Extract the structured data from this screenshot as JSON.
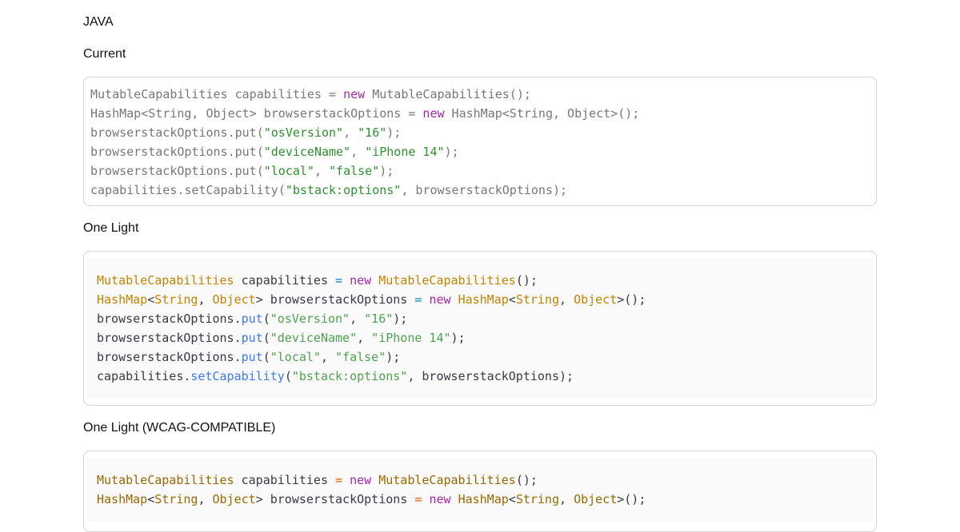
{
  "language_heading": "JAVA",
  "sections": {
    "current": {
      "label": "Current",
      "lines": [
        [
          [
            "plain",
            "MutableCapabilities capabilities = "
          ],
          [
            "kw",
            "new"
          ],
          [
            "plain",
            " MutableCapabilities();"
          ]
        ],
        [
          [
            "plain",
            "HashMap<String, Object> browserstackOptions = "
          ],
          [
            "kw",
            "new"
          ],
          [
            "plain",
            " HashMap<String, Object>();"
          ]
        ],
        [
          [
            "plain",
            "browserstackOptions.put("
          ],
          [
            "str",
            "\"osVersion\""
          ],
          [
            "plain",
            ", "
          ],
          [
            "str",
            "\"16\""
          ],
          [
            "plain",
            ");"
          ]
        ],
        [
          [
            "plain",
            "browserstackOptions.put("
          ],
          [
            "str",
            "\"deviceName\""
          ],
          [
            "plain",
            ", "
          ],
          [
            "str",
            "\"iPhone 14\""
          ],
          [
            "plain",
            ");"
          ]
        ],
        [
          [
            "plain",
            "browserstackOptions.put("
          ],
          [
            "str",
            "\"local\""
          ],
          [
            "plain",
            ", "
          ],
          [
            "str",
            "\"false\""
          ],
          [
            "plain",
            ");"
          ]
        ],
        [
          [
            "plain",
            "capabilities.setCapability("
          ],
          [
            "str",
            "\"bstack:options\""
          ],
          [
            "plain",
            ", browserstackOptions);"
          ]
        ]
      ]
    },
    "one_light": {
      "label": "One Light",
      "lines": [
        [
          [
            "type",
            "MutableCapabilities"
          ],
          [
            "plain",
            " capabilities "
          ],
          [
            "op",
            "="
          ],
          [
            "plain",
            " "
          ],
          [
            "kw",
            "new"
          ],
          [
            "plain",
            " "
          ],
          [
            "type",
            "MutableCapabilities"
          ],
          [
            "plain",
            "();"
          ]
        ],
        [
          [
            "type",
            "HashMap"
          ],
          [
            "plain",
            "<"
          ],
          [
            "type",
            "String"
          ],
          [
            "plain",
            ", "
          ],
          [
            "type",
            "Object"
          ],
          [
            "plain",
            "> browserstackOptions "
          ],
          [
            "op",
            "="
          ],
          [
            "plain",
            " "
          ],
          [
            "kw",
            "new"
          ],
          [
            "plain",
            " "
          ],
          [
            "type",
            "HashMap"
          ],
          [
            "plain",
            "<"
          ],
          [
            "type",
            "String"
          ],
          [
            "plain",
            ", "
          ],
          [
            "type",
            "Object"
          ],
          [
            "plain",
            ">();"
          ]
        ],
        [
          [
            "plain",
            "browserstackOptions."
          ],
          [
            "fn",
            "put"
          ],
          [
            "plain",
            "("
          ],
          [
            "str",
            "\"osVersion\""
          ],
          [
            "plain",
            ", "
          ],
          [
            "str",
            "\"16\""
          ],
          [
            "plain",
            ");"
          ]
        ],
        [
          [
            "plain",
            "browserstackOptions."
          ],
          [
            "fn",
            "put"
          ],
          [
            "plain",
            "("
          ],
          [
            "str",
            "\"deviceName\""
          ],
          [
            "plain",
            ", "
          ],
          [
            "str",
            "\"iPhone 14\""
          ],
          [
            "plain",
            ");"
          ]
        ],
        [
          [
            "plain",
            "browserstackOptions."
          ],
          [
            "fn",
            "put"
          ],
          [
            "plain",
            "("
          ],
          [
            "str",
            "\"local\""
          ],
          [
            "plain",
            ", "
          ],
          [
            "str",
            "\"false\""
          ],
          [
            "plain",
            ");"
          ]
        ],
        [
          [
            "plain",
            "capabilities."
          ],
          [
            "fn",
            "setCapability"
          ],
          [
            "plain",
            "("
          ],
          [
            "str",
            "\"bstack:options\""
          ],
          [
            "plain",
            ", browserstackOptions);"
          ]
        ]
      ]
    },
    "one_light_wcag": {
      "label": "One Light (WCAG-COMPATIBLE)",
      "lines": [
        [
          [
            "type",
            "MutableCapabilities"
          ],
          [
            "plain",
            " capabilities "
          ],
          [
            "op",
            "="
          ],
          [
            "plain",
            " "
          ],
          [
            "kw",
            "new"
          ],
          [
            "plain",
            " "
          ],
          [
            "type",
            "MutableCapabilities"
          ],
          [
            "plain",
            "();"
          ]
        ],
        [
          [
            "type",
            "HashMap"
          ],
          [
            "plain",
            "<"
          ],
          [
            "type",
            "String"
          ],
          [
            "plain",
            ", "
          ],
          [
            "type",
            "Object"
          ],
          [
            "plain",
            "> browserstackOptions "
          ],
          [
            "op",
            "="
          ],
          [
            "plain",
            " "
          ],
          [
            "kw",
            "new"
          ],
          [
            "plain",
            " "
          ],
          [
            "type",
            "HashMap"
          ],
          [
            "plain",
            "<"
          ],
          [
            "type",
            "String"
          ],
          [
            "plain",
            ", "
          ],
          [
            "type",
            "Object"
          ],
          [
            "plain",
            ">();"
          ]
        ]
      ]
    }
  },
  "colors": {
    "current_keyword": "#a626a4",
    "current_string": "#2f8f2f",
    "one_light_type": "#c18401",
    "one_light_string": "#50a14f",
    "one_light_function": "#4078f2",
    "one_light_operator": "#0184bc",
    "wcag_type": "#986801",
    "wcag_operator": "#d75f00",
    "border": "#d4d4d4",
    "code_background": "#fafafa"
  }
}
